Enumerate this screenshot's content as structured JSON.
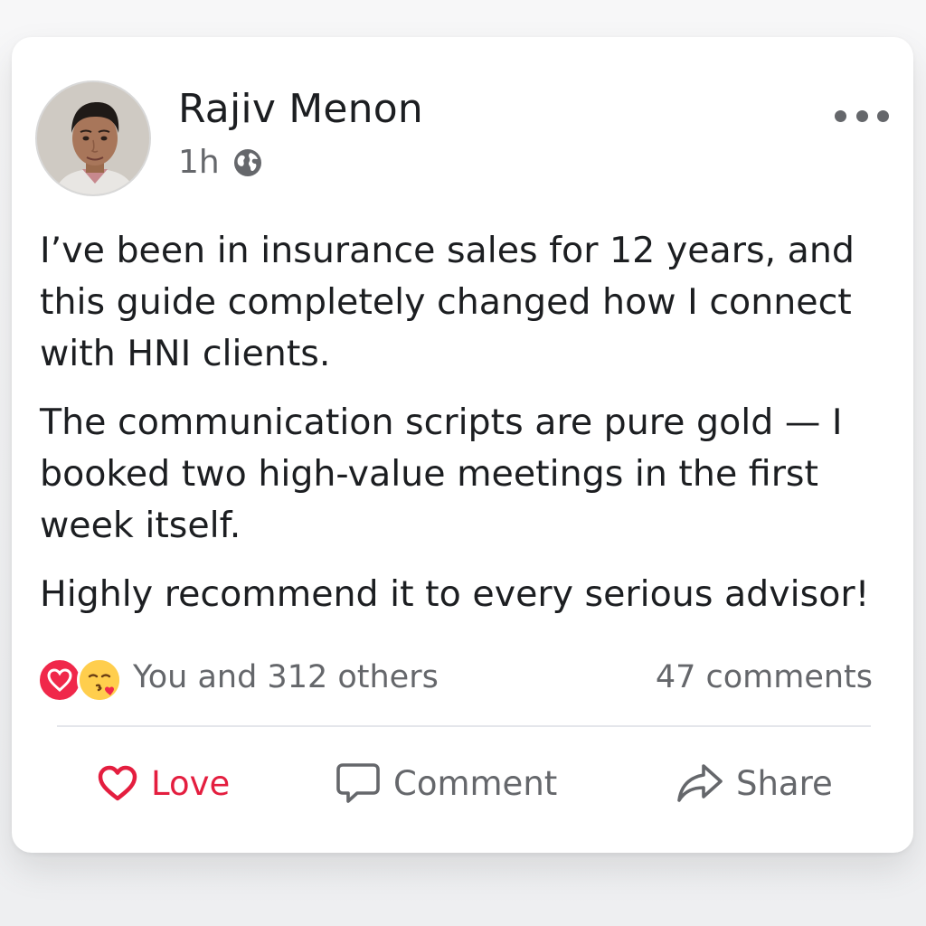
{
  "post": {
    "author": "Rajiv Menon",
    "time": "1h",
    "audience_icon": "globe-icon",
    "body": [
      "I’ve been in insurance sales for 12 years, and this guide completely changed how I connect with HNI clients.",
      "The communication scripts are pure gold — I booked two high-value meetings in the first week itself.",
      "Highly recommend it to every serious advisor!"
    ],
    "reactions": {
      "types": [
        "heart-icon",
        "kiss-face-icon"
      ],
      "summary": "You and 312 others",
      "comments": "47 comments"
    },
    "actions": {
      "love": "Love",
      "comment": "Comment",
      "share": "Share"
    }
  },
  "colors": {
    "love_red": "#e41e3f",
    "muted_text": "#65676b",
    "primary_text": "#1c1e21",
    "card_bg": "#ffffff"
  }
}
